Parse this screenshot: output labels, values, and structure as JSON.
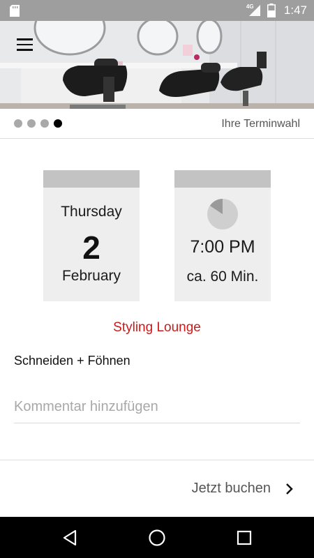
{
  "status_bar": {
    "network_label": "4G",
    "time": "1:47",
    "icons": [
      "sd-card-icon",
      "signal-icon",
      "battery-icon"
    ]
  },
  "header": {
    "menu_icon": "hamburger-menu-icon"
  },
  "pager": {
    "total_steps": 4,
    "active_step": 4,
    "title": "Ihre Terminwahl"
  },
  "appointment": {
    "date": {
      "weekday": "Thursday",
      "day": "2",
      "month": "February"
    },
    "time": {
      "icon": "clock-icon",
      "value": "7:00 PM",
      "duration": "ca. 60 Min."
    },
    "salon": "Styling Lounge",
    "service": "Schneiden + Föhnen"
  },
  "comment": {
    "value": "",
    "placeholder": "Kommentar hinzufügen"
  },
  "book": {
    "label": "Jetzt buchen",
    "icon": "chevron-right-icon"
  },
  "colors": {
    "accent": "#cc1a1a",
    "status_bar": "#9e9e9e",
    "card_bg": "#eeeeee",
    "card_cap": "#c3c3c3",
    "nav_bar": "#000000"
  },
  "nav": {
    "icons": [
      "back-icon",
      "home-icon",
      "recents-icon"
    ]
  }
}
